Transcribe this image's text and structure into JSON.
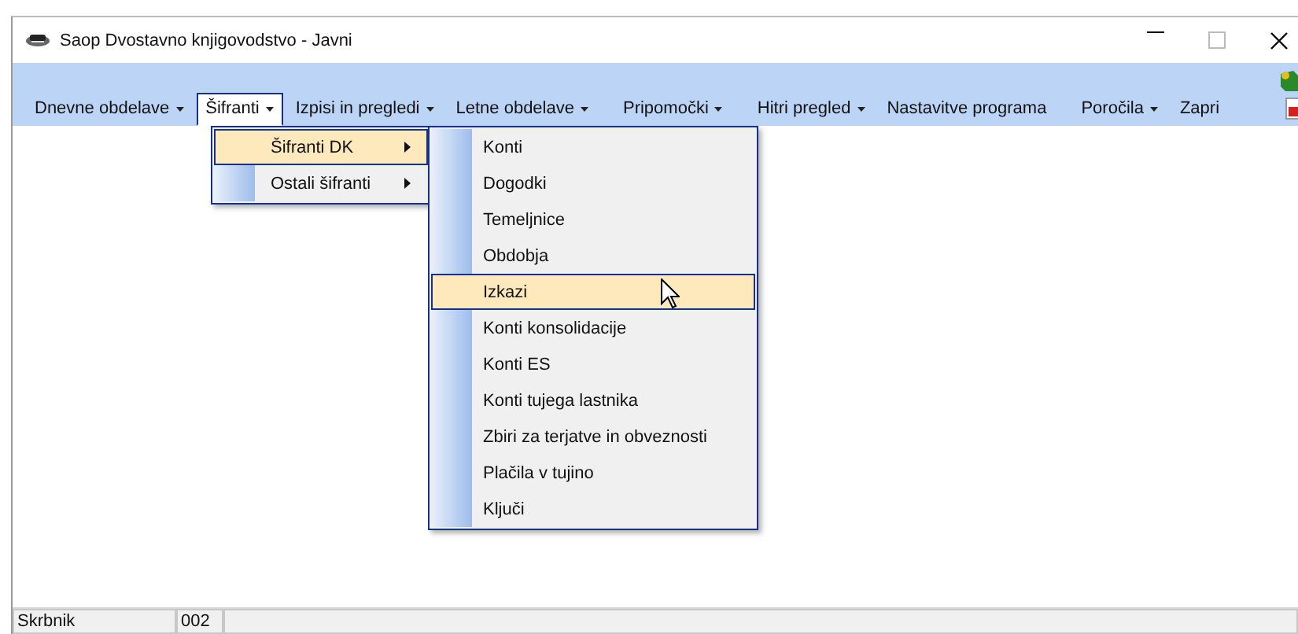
{
  "window": {
    "title": "Saop Dvostavno knjigovodstvo - Javni"
  },
  "menu_bar": [
    {
      "label": "Dnevne obdelave",
      "has_dropdown": true,
      "selected": false
    },
    {
      "label": "Šifranti",
      "has_dropdown": true,
      "selected": true
    },
    {
      "label": "Izpisi in pregledi",
      "has_dropdown": true,
      "selected": false
    },
    {
      "label": "Letne obdelave",
      "has_dropdown": true,
      "selected": false
    },
    {
      "label": "Pripomočki",
      "has_dropdown": true,
      "selected": false
    },
    {
      "label": "Hitri pregled",
      "has_dropdown": true,
      "selected": false
    },
    {
      "label": "Nastavitve programa",
      "has_dropdown": false,
      "selected": false
    },
    {
      "label": "Poročila",
      "has_dropdown": true,
      "selected": false
    },
    {
      "label": "Zapri",
      "has_dropdown": false,
      "selected": false
    }
  ],
  "submenu": [
    {
      "label": "Šifranti DK",
      "has_submenu": true,
      "selected": true
    },
    {
      "label": "Ostali šifranti",
      "has_submenu": true,
      "selected": false
    }
  ],
  "submenu_2": [
    {
      "label": "Konti",
      "selected": false
    },
    {
      "label": "Dogodki",
      "selected": false
    },
    {
      "label": "Temeljnice",
      "selected": false
    },
    {
      "label": "Obdobja",
      "selected": false
    },
    {
      "label": "Izkazi",
      "selected": true
    },
    {
      "label": "Konti konsolidacije",
      "selected": false
    },
    {
      "label": "Konti ES",
      "selected": false
    },
    {
      "label": "Konti tujega lastnika",
      "selected": false
    },
    {
      "label": "Zbiri za terjatve in obveznosti",
      "selected": false
    },
    {
      "label": "Plačila v tujino",
      "selected": false
    },
    {
      "label": "Ključi",
      "selected": false
    }
  ],
  "status_bar": [
    "Skrbnik",
    "002"
  ]
}
